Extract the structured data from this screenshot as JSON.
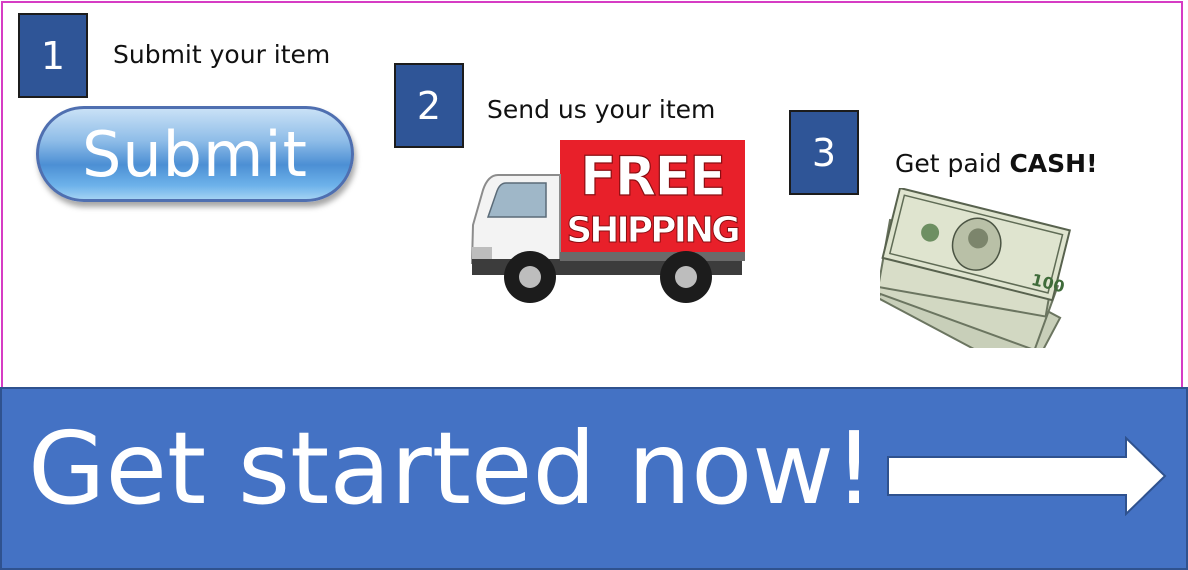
{
  "steps": [
    {
      "number": "1",
      "text": "Submit your item"
    },
    {
      "number": "2",
      "text": "Send us your item"
    },
    {
      "number": "3",
      "text_prefix": "Get paid ",
      "text_bold": "CASH!"
    }
  ],
  "submit_button": {
    "label": "Submit"
  },
  "free_shipping": {
    "line1": "FREE",
    "line2": "SHIPPING"
  },
  "cta": {
    "label": "Get started now!"
  },
  "colors": {
    "frame_border": "#d63cc4",
    "step_box": "#2f5597",
    "banner": "#4472c4",
    "shipping_red": "#e8202a"
  },
  "icons": [
    "delivery-truck-image",
    "cash-bills-image",
    "right-arrow-icon"
  ]
}
